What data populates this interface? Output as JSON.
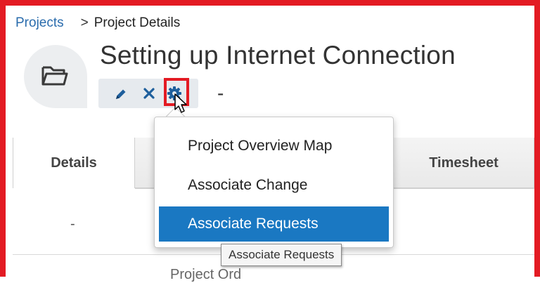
{
  "breadcrumb": {
    "root": "Projects",
    "separator": ">",
    "current": "Project Details"
  },
  "project": {
    "title": "Setting up Internet Connection",
    "status_value": "-",
    "avatar_icon": "folder-icon"
  },
  "toolbar": {
    "edit_icon": "pencil-icon",
    "delete_icon": "close-icon",
    "settings_icon": "gear-icon"
  },
  "tabs": [
    {
      "label": "Details"
    },
    {
      "label": ""
    },
    {
      "label": "Timesheet"
    }
  ],
  "details": {
    "cell_value": "-",
    "section_partial": "Project Ord"
  },
  "settings_menu": {
    "items": [
      {
        "label": "Project Overview Map"
      },
      {
        "label": "Associate Change"
      },
      {
        "label": "Associate Requests",
        "active": true
      }
    ],
    "tooltip": "Associate Requests"
  },
  "colors": {
    "highlight_border": "#e31b23",
    "link": "#2a6cad",
    "menu_active": "#1a78c2",
    "toolbar_icon": "#1e5f9c"
  }
}
